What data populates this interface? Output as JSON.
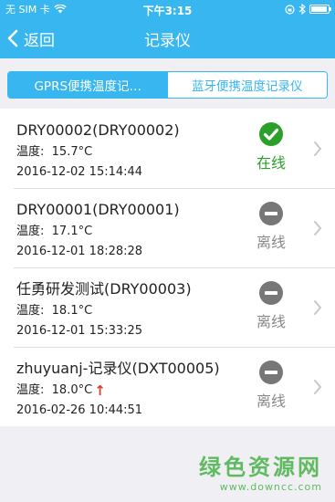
{
  "status_bar": {
    "carrier": "无 SIM 卡",
    "time": "下午3:15"
  },
  "nav": {
    "back_label": "返回",
    "title": "记录仪"
  },
  "tabs": [
    {
      "label": "GPRS便携温度记…",
      "active": true
    },
    {
      "label": "蓝牙便携温度记录仪",
      "active": false
    }
  ],
  "devices": [
    {
      "name": "DRY00002(DRY00002)",
      "temp_label": "温度:",
      "temp": "15.7°C",
      "time": "2016-12-02 15:14:44",
      "status": "在线",
      "status_icon": "check-circle-icon",
      "online": true,
      "alert": ""
    },
    {
      "name": "DRY00001(DRY00001)",
      "temp_label": "温度:",
      "temp": "17.1°C",
      "time": "2016-12-01 18:28:28",
      "status": "离线",
      "status_icon": "minus-circle-icon",
      "online": false,
      "alert": ""
    },
    {
      "name": "任勇研发测试(DRY00003)",
      "temp_label": "温度:",
      "temp": "18.1°C",
      "time": "2016-12-01 15:33:25",
      "status": "离线",
      "status_icon": "minus-circle-icon",
      "online": false,
      "alert": ""
    },
    {
      "name": "zhuyuanj-记录仪(DXT00005)",
      "temp_label": "温度:",
      "temp": "18.0°C",
      "time": "2016-02-26 10:44:51",
      "status": "离线",
      "status_icon": "minus-circle-icon",
      "online": false,
      "alert": "↑"
    }
  ],
  "watermark": {
    "main": "绿色资源网",
    "sub": "www.downcc.com"
  },
  "colors": {
    "primary": "#37b6f0",
    "online": "#2aa02a",
    "offline": "#888888",
    "alert": "#e23a2a"
  }
}
